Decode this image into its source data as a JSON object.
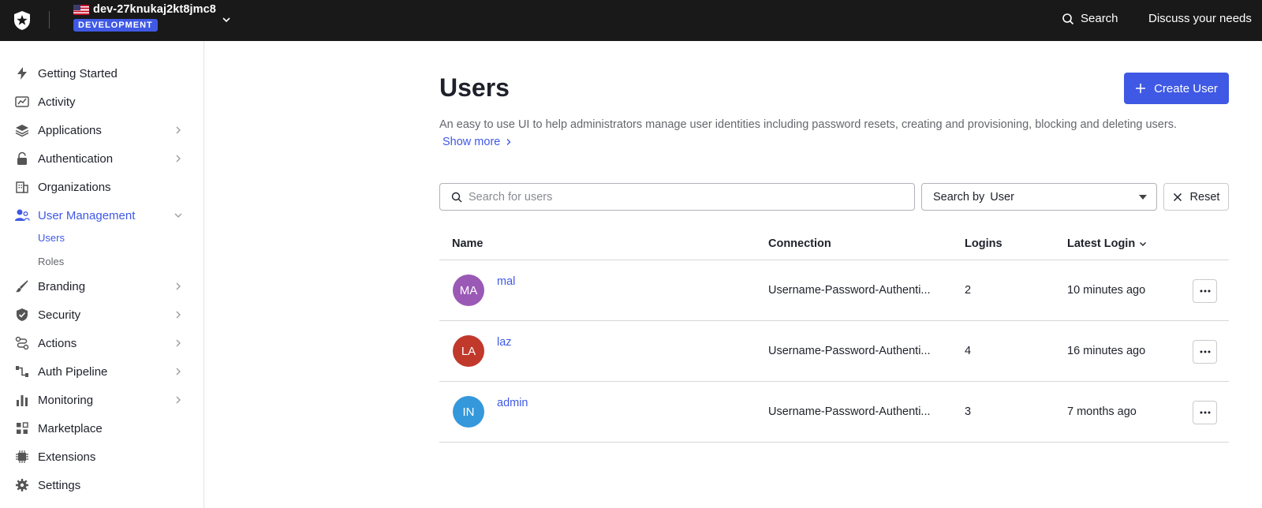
{
  "topbar": {
    "tenant_name": "dev-27knukaj2kt8jmc8",
    "env_badge": "DEVELOPMENT",
    "search_label": "Search",
    "discuss_label": "Discuss your needs"
  },
  "sidebar": {
    "items": [
      {
        "label": "Getting Started",
        "icon": "lightning-icon"
      },
      {
        "label": "Activity",
        "icon": "chart-icon"
      },
      {
        "label": "Applications",
        "icon": "layers-icon"
      },
      {
        "label": "Authentication",
        "icon": "lock-icon"
      },
      {
        "label": "Organizations",
        "icon": "building-icon"
      },
      {
        "label": "User Management",
        "icon": "users-icon"
      },
      {
        "label": "Branding",
        "icon": "brush-icon"
      },
      {
        "label": "Security",
        "icon": "shield-icon"
      },
      {
        "label": "Actions",
        "icon": "flow-icon"
      },
      {
        "label": "Auth Pipeline",
        "icon": "pipeline-icon"
      },
      {
        "label": "Monitoring",
        "icon": "bar-chart-icon"
      },
      {
        "label": "Marketplace",
        "icon": "grid-icon"
      },
      {
        "label": "Extensions",
        "icon": "chip-icon"
      },
      {
        "label": "Settings",
        "icon": "gear-icon"
      }
    ],
    "sub_items": [
      {
        "label": "Users"
      },
      {
        "label": "Roles"
      }
    ]
  },
  "main": {
    "title": "Users",
    "create_button": "Create User",
    "description": "An easy to use UI to help administrators manage user identities including password resets, creating and provisioning, blocking and deleting users.",
    "show_more": "Show more",
    "search_placeholder": "Search for users",
    "search_by_label": "Search by",
    "search_by_value": "User",
    "reset_label": "Reset"
  },
  "table": {
    "headers": {
      "name": "Name",
      "connection": "Connection",
      "logins": "Logins",
      "latest_login": "Latest Login"
    },
    "rows": [
      {
        "initials": "MA",
        "name": "mal",
        "connection": "Username-Password-Authenti...",
        "logins": "2",
        "latest_login": "10 minutes ago",
        "color": "#9b59b6"
      },
      {
        "initials": "LA",
        "name": "laz",
        "connection": "Username-Password-Authenti...",
        "logins": "4",
        "latest_login": "16 minutes ago",
        "color": "#c0392b"
      },
      {
        "initials": "IN",
        "name": "admin",
        "connection": "Username-Password-Authenti...",
        "logins": "3",
        "latest_login": "7 months ago",
        "color": "#3498db"
      }
    ]
  },
  "colors": {
    "accent": "#3f59e4",
    "topbar": "#191919"
  }
}
